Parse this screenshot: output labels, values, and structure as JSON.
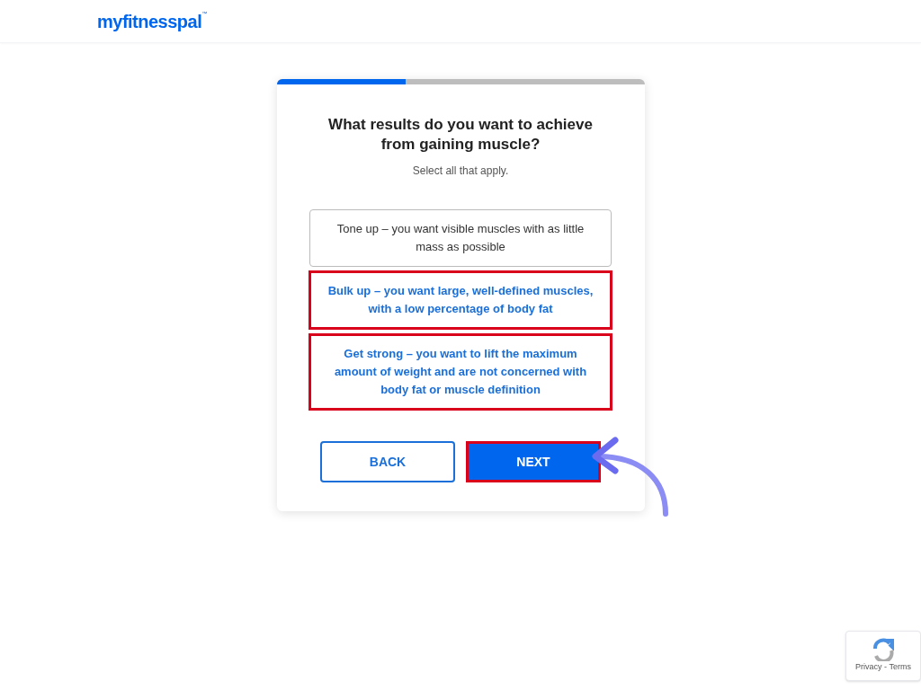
{
  "header": {
    "logo": "myfitnesspal",
    "logo_mark": "™"
  },
  "progress": {
    "level": 0.35
  },
  "question": {
    "title": "What results do you want to achieve from gaining muscle?",
    "hint": "Select all that apply."
  },
  "options": [
    {
      "label": "Tone up – you want visible muscles with as little mass as possible",
      "selected": false
    },
    {
      "label": "Bulk up – you want large, well-defined muscles, with a low percentage of body fat",
      "selected": true
    },
    {
      "label": "Get strong – you want to lift the maximum amount of weight and are not concerned with body fat or muscle definition",
      "selected": true
    }
  ],
  "buttons": [
    {
      "label": "BACK",
      "kind": "secondary",
      "highlighted": false
    },
    {
      "label": "NEXT",
      "kind": "primary",
      "highlighted": true
    }
  ],
  "recaptcha": {
    "links": "Privacy - Terms"
  }
}
